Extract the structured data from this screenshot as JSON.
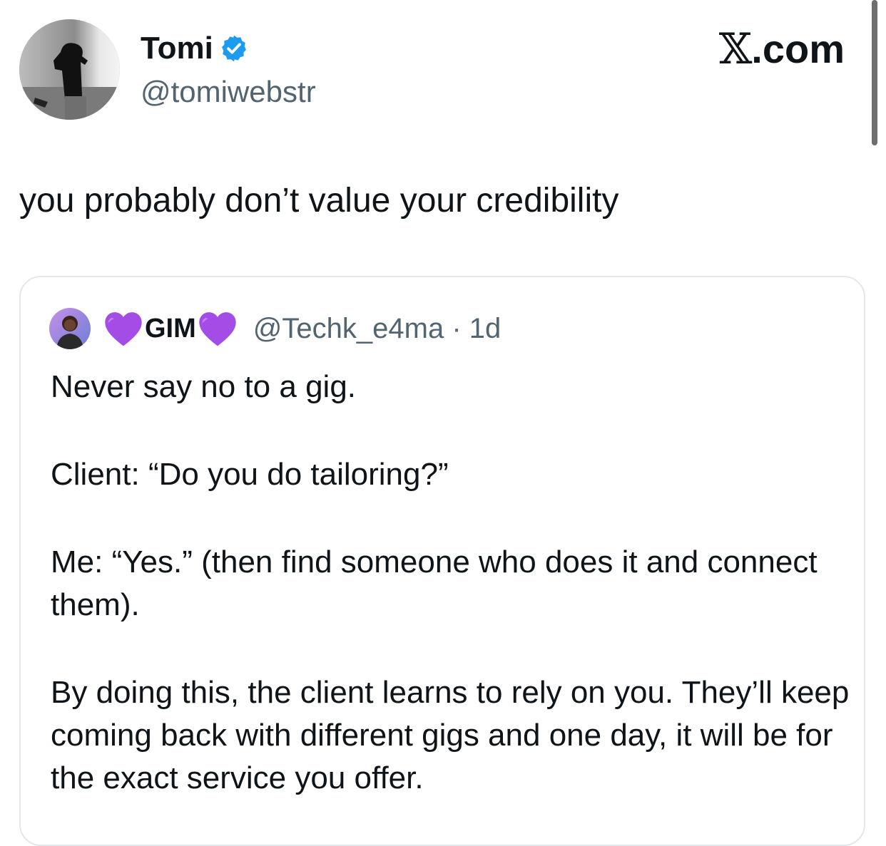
{
  "author": {
    "display_name": "Tomi",
    "handle": "@tomiwebstr",
    "verified": true
  },
  "brand": {
    "label": ".com",
    "logo_glyph": "𝕏"
  },
  "tweet": {
    "text": "you probably don’t value your credibility"
  },
  "quoted": {
    "display_name": "GIM",
    "name_emoji": "purple-heart",
    "handle": "@Techk_e4ma",
    "separator": "·",
    "age": "1d",
    "paragraphs": [
      "Never say no to a gig.",
      "Client: “Do you do tailoring?”",
      "Me: “Yes.” (then find someone who does it and connect them).",
      "By doing this, the client learns to rely on you. They’ll keep coming back with different gigs and one day, it will be for the exact service you offer."
    ]
  },
  "colors": {
    "verified_blue": "#1d9bf0",
    "secondary_text": "#536471",
    "primary_text": "#0f1419",
    "heart_purple": "#a34ce6",
    "card_border": "#e3e7ea"
  }
}
